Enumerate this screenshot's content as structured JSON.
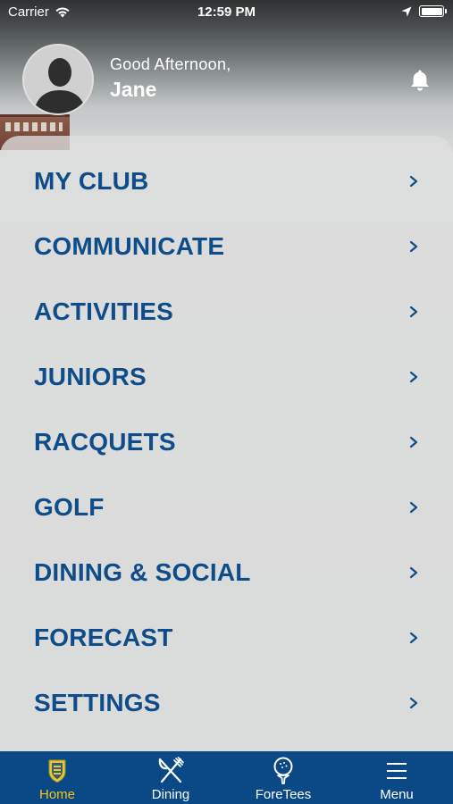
{
  "status_bar": {
    "carrier": "Carrier",
    "time": "12:59 PM"
  },
  "header": {
    "greeting": "Good Afternoon,",
    "user_name": "Jane",
    "avatar_icon": "person-silhouette-icon",
    "notification_icon": "bell-icon"
  },
  "menu": {
    "items": [
      {
        "label": "MY CLUB"
      },
      {
        "label": "COMMUNICATE"
      },
      {
        "label": "ACTIVITIES"
      },
      {
        "label": "JUNIORS"
      },
      {
        "label": "RACQUETS"
      },
      {
        "label": "GOLF"
      },
      {
        "label": "DINING & SOCIAL"
      },
      {
        "label": "FORECAST"
      },
      {
        "label": "SETTINGS"
      }
    ]
  },
  "tab_bar": {
    "tabs": [
      {
        "label": "Home",
        "icon": "club-crest-icon",
        "active": true
      },
      {
        "label": "Dining",
        "icon": "fork-knife-icon",
        "active": false
      },
      {
        "label": "ForeTees",
        "icon": "golf-ball-tee-icon",
        "active": false
      },
      {
        "label": "Menu",
        "icon": "hamburger-menu-icon",
        "active": false
      }
    ]
  },
  "colors": {
    "accent": "#0e4c8a",
    "tab_bar_bg": "#0b4986",
    "active_tab": "#f4c41a"
  }
}
